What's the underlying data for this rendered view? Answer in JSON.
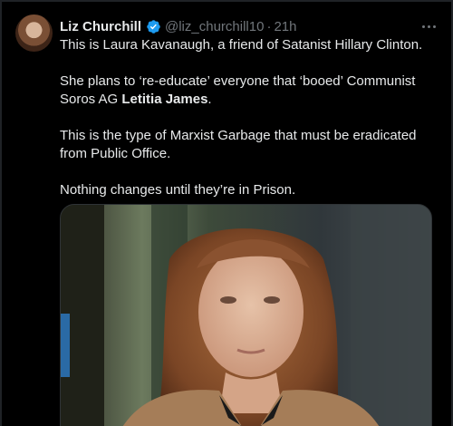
{
  "tweet": {
    "display_name": "Liz Churchill",
    "handle": "@liz_churchill10",
    "separator": "·",
    "time": "21h",
    "verified_icon": "verified-badge-icon",
    "more_icon": "more-options-icon",
    "paragraphs": [
      {
        "before": "This is Laura Kavanaugh, a friend of Satanist Hillary Clinton.",
        "bold": "",
        "after": ""
      },
      {
        "before": "She plans to ‘re-educate’ everyone that ‘booed’ Communist Soros AG ",
        "bold": "Letitia James",
        "after": "."
      },
      {
        "before": "This is the type of Marxist Garbage that must be eradicated from Public Office.",
        "bold": "",
        "after": ""
      },
      {
        "before": "Nothing changes until they’re in Prison.",
        "bold": "",
        "after": ""
      }
    ]
  },
  "colors": {
    "background": "#000000",
    "primary_text": "#e7e9ea",
    "secondary_text": "#71767b",
    "verified_blue": "#1d9bf0"
  }
}
